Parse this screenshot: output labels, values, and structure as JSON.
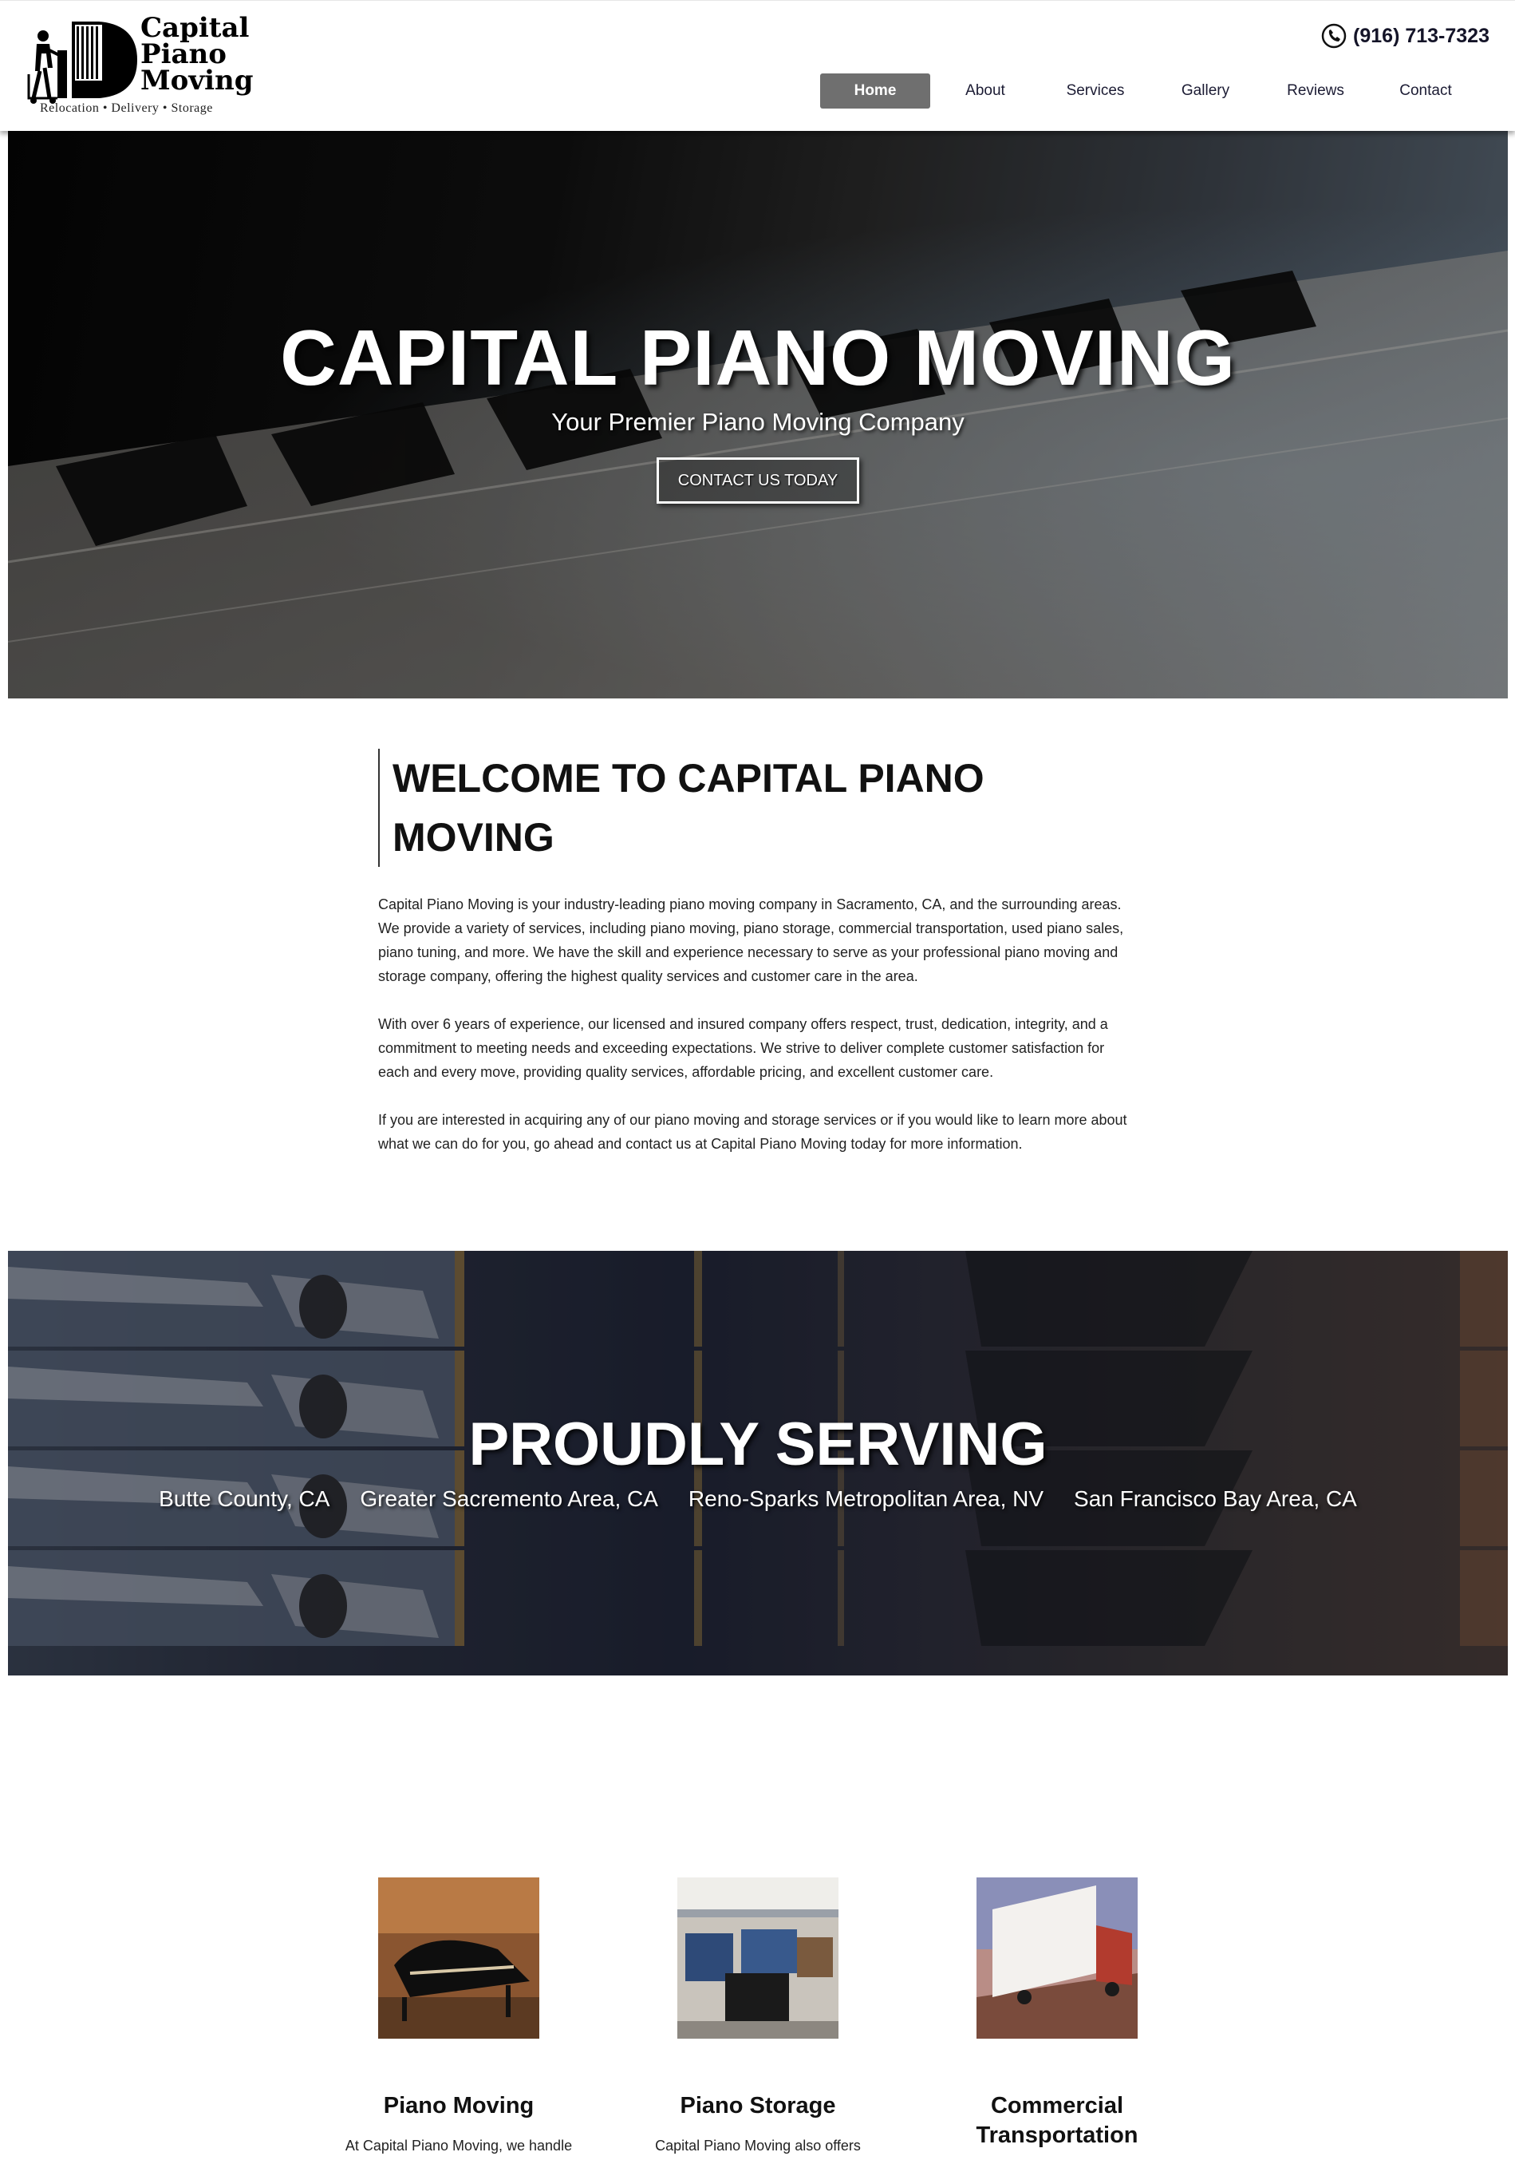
{
  "header": {
    "logo": {
      "line1": "Capital",
      "line2": "Piano",
      "line3": "Moving",
      "tagline": "Relocation • Delivery • Storage"
    },
    "phone": "(916) 713-7323",
    "nav": [
      {
        "label": "Home",
        "active": true
      },
      {
        "label": "About",
        "active": false
      },
      {
        "label": "Services",
        "active": false
      },
      {
        "label": "Gallery",
        "active": false
      },
      {
        "label": "Reviews",
        "active": false
      },
      {
        "label": "Contact",
        "active": false
      }
    ]
  },
  "hero": {
    "title": "CAPITAL PIANO MOVING",
    "subtitle": "Your Premier Piano Moving Company",
    "button": "CONTACT US TODAY"
  },
  "welcome": {
    "title": "WELCOME TO CAPITAL PIANO MOVING",
    "paragraphs": [
      "Capital Piano Moving is your industry-leading piano moving company in Sacramento, CA, and the surrounding areas. We provide a variety of services, including piano moving, piano storage, commercial transportation, used piano sales, piano tuning, and more. We have the skill and experience necessary to serve as your professional piano moving and storage company, offering the highest quality services and customer care in the area.",
      "With over 6 years of experience, our licensed and insured company offers respect, trust, dedication, integrity, and a commitment to meeting needs and exceeding expectations. We strive to deliver complete customer satisfaction for each and every move, providing quality services, affordable pricing, and excellent customer care.",
      "If you are interested in acquiring any of our piano moving and storage services or if you would like to learn more about what we can do for you, go ahead and contact us at Capital Piano Moving today for more information."
    ]
  },
  "serving": {
    "title": "PROUDLY SERVING",
    "areas": [
      "Butte County, CA",
      "Greater Sacremento Area, CA",
      "Reno-Sparks Metropolitan Area, NV",
      "San Francisco Bay Area, CA"
    ]
  },
  "services": [
    {
      "title": "Piano Moving",
      "desc": "At Capital Piano Moving, we handle"
    },
    {
      "title": "Piano Storage",
      "desc": "Capital Piano Moving also offers"
    },
    {
      "title": "Commercial Transportation",
      "desc": ""
    }
  ],
  "colors": {
    "nav_active": "#6f6f6f",
    "text_dark": "#111111",
    "nav_text": "#1b1b33"
  }
}
